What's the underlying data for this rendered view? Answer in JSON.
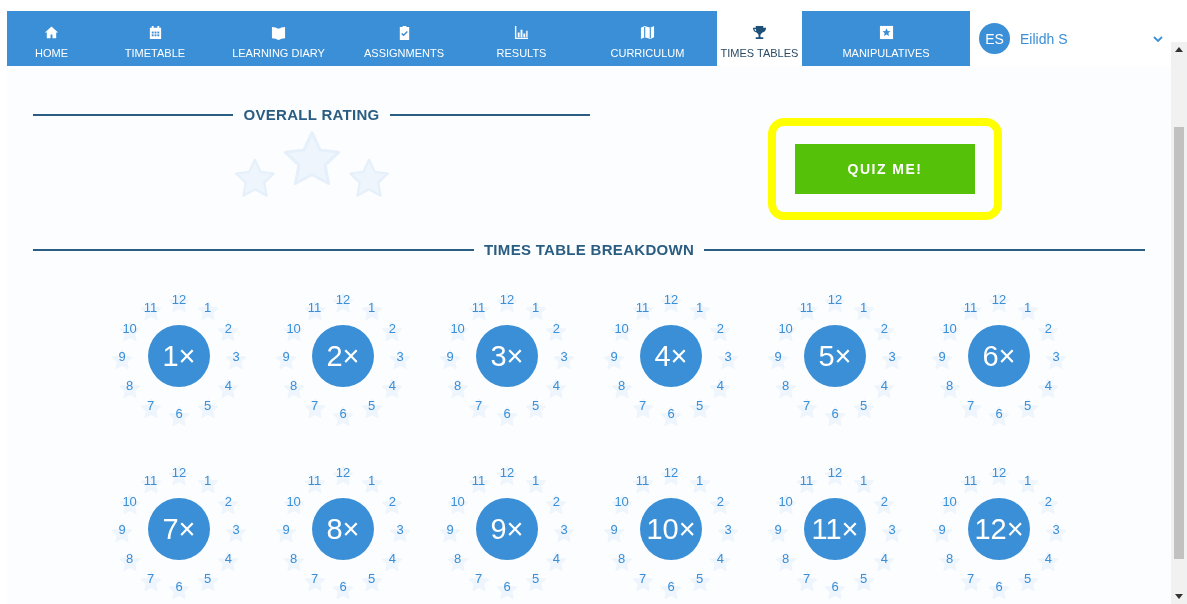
{
  "nav": {
    "items": [
      {
        "label": "HOME",
        "selected": false
      },
      {
        "label": "TIMETABLE",
        "selected": false
      },
      {
        "label": "LEARNING DIARY",
        "selected": false
      },
      {
        "label": "ASSIGNMENTS",
        "selected": false
      },
      {
        "label": "RESULTS",
        "selected": false
      },
      {
        "label": "CURRICULUM",
        "selected": false
      },
      {
        "label": "TIMES TABLES",
        "selected": true
      },
      {
        "label": "MANIPULATIVES",
        "selected": false
      }
    ],
    "user": {
      "initials": "ES",
      "name": "Eilidh S"
    }
  },
  "overall_rating": {
    "heading": "OVERALL RATING",
    "stars": 0
  },
  "quiz_button": {
    "label": "QUIZ ME!",
    "highlighted": true
  },
  "breakdown": {
    "heading": "TIMES TABLE BREAKDOWN",
    "tables": [
      {
        "label": "1×",
        "numbers": [
          "1",
          "2",
          "3",
          "4",
          "5",
          "6",
          "7",
          "8",
          "9",
          "10",
          "11",
          "12"
        ]
      },
      {
        "label": "2×",
        "numbers": [
          "1",
          "2",
          "3",
          "4",
          "5",
          "6",
          "7",
          "8",
          "9",
          "10",
          "11",
          "12"
        ]
      },
      {
        "label": "3×",
        "numbers": [
          "1",
          "2",
          "3",
          "4",
          "5",
          "6",
          "7",
          "8",
          "9",
          "10",
          "11",
          "12"
        ]
      },
      {
        "label": "4×",
        "numbers": [
          "1",
          "2",
          "3",
          "4",
          "5",
          "6",
          "7",
          "8",
          "9",
          "10",
          "11",
          "12"
        ]
      },
      {
        "label": "5×",
        "numbers": [
          "1",
          "2",
          "3",
          "4",
          "5",
          "6",
          "7",
          "8",
          "9",
          "10",
          "11",
          "12"
        ]
      },
      {
        "label": "6×",
        "numbers": [
          "1",
          "2",
          "3",
          "4",
          "5",
          "6",
          "7",
          "8",
          "9",
          "10",
          "11",
          "12"
        ]
      },
      {
        "label": "7×",
        "numbers": [
          "1",
          "2",
          "3",
          "4",
          "5",
          "6",
          "7",
          "8",
          "9",
          "10",
          "11",
          "12"
        ]
      },
      {
        "label": "8×",
        "numbers": [
          "1",
          "2",
          "3",
          "4",
          "5",
          "6",
          "7",
          "8",
          "9",
          "10",
          "11",
          "12"
        ]
      },
      {
        "label": "9×",
        "numbers": [
          "1",
          "2",
          "3",
          "4",
          "5",
          "6",
          "7",
          "8",
          "9",
          "10",
          "11",
          "12"
        ]
      },
      {
        "label": "10×",
        "numbers": [
          "1",
          "2",
          "3",
          "4",
          "5",
          "6",
          "7",
          "8",
          "9",
          "10",
          "11",
          "12"
        ]
      },
      {
        "label": "11×",
        "numbers": [
          "1",
          "2",
          "3",
          "4",
          "5",
          "6",
          "7",
          "8",
          "9",
          "10",
          "11",
          "12"
        ]
      },
      {
        "label": "12×",
        "numbers": [
          "1",
          "2",
          "3",
          "4",
          "5",
          "6",
          "7",
          "8",
          "9",
          "10",
          "11",
          "12"
        ]
      }
    ]
  }
}
